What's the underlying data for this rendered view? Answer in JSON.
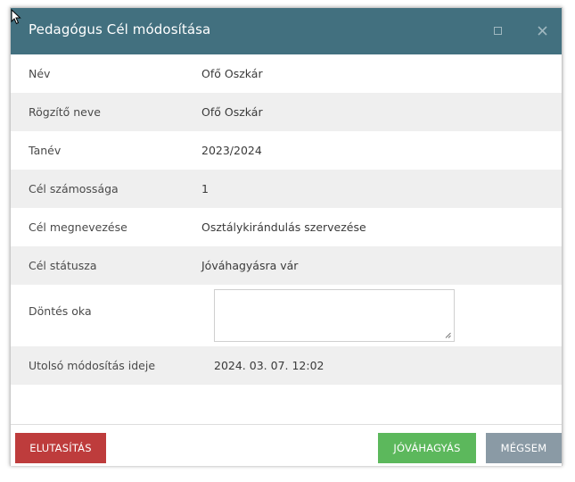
{
  "dialog": {
    "title": "Pedagógus Cél módosítása"
  },
  "fields": [
    {
      "label": "Név",
      "value": "Ofő Oszkár"
    },
    {
      "label": "Rögzítő neve",
      "value": "Ofő Oszkár"
    },
    {
      "label": "Tanév",
      "value": "2023/2024"
    },
    {
      "label": "Cél számossága",
      "value": "1"
    },
    {
      "label": "Cél megnevezése",
      "value": "Osztálykirándulás szervezése"
    },
    {
      "label": "Cél státusza",
      "value": "Jóváhagyásra vár"
    }
  ],
  "decision": {
    "label": "Döntés oka",
    "value": "",
    "placeholder": ""
  },
  "last_modified": {
    "label": "Utolsó módosítás ideje",
    "value": "2024. 03. 07. 12:02"
  },
  "buttons": {
    "reject": "ELUTASÍTÁS",
    "approve": "JÓVÁHAGYÁS",
    "cancel": "MÉGSEM"
  },
  "colors": {
    "titlebar": "#42707f",
    "reject": "#be3c3c",
    "approve": "#5cb85c",
    "cancel": "#8a9aa5",
    "row_alt": "#efefef"
  },
  "icons": {
    "maximize": "maximize-icon",
    "close": "close-icon",
    "resize": "resize-grip-icon",
    "cursor": "mouse-pointer-icon"
  }
}
